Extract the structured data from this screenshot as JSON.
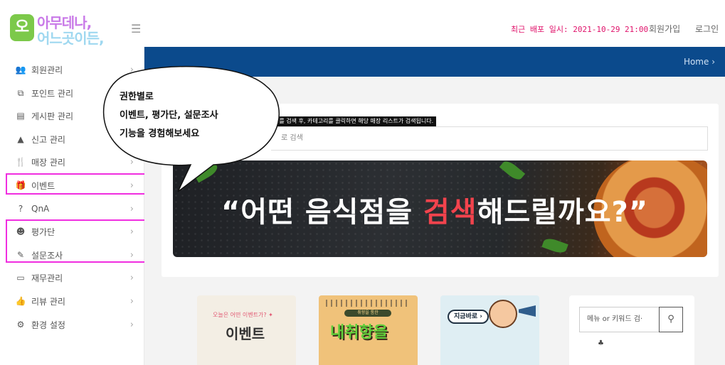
{
  "header": {
    "logo_badge": "오",
    "logo_line1": "아무데나,",
    "logo_line2": "어느곳이든,",
    "menu_icon": "hamburger-icon",
    "deploy_text": "최근 배포 일시: 2021-10-29 21:00",
    "signup": "회원가입",
    "login": "로그인",
    "accent_color": "#e0116a"
  },
  "sidebar": {
    "items": [
      {
        "icon": "users-icon",
        "glyph": "👥",
        "label": "회원관리",
        "arrow": "›"
      },
      {
        "icon": "point-icon",
        "glyph": "⧉",
        "label": "포인트 관리",
        "arrow": "›"
      },
      {
        "icon": "document-icon",
        "glyph": "▤",
        "label": "게시판 관리",
        "arrow": "›"
      },
      {
        "icon": "warning-icon",
        "glyph": "▲",
        "label": "신고 관리",
        "arrow": "›"
      },
      {
        "icon": "restaurant-icon",
        "glyph": "🍴",
        "label": "매장 관리",
        "arrow": "›"
      },
      {
        "icon": "gift-icon",
        "glyph": "🎁",
        "label": "이벤트",
        "arrow": "›"
      },
      {
        "icon": "question-icon",
        "glyph": "?",
        "label": "QnA",
        "arrow": "›"
      },
      {
        "icon": "smile-icon",
        "glyph": "☻",
        "label": "평가단",
        "arrow": "›"
      },
      {
        "icon": "edit-icon",
        "glyph": "✎",
        "label": "설문조사",
        "arrow": "›"
      },
      {
        "icon": "card-icon",
        "glyph": "▭",
        "label": "재무관리",
        "arrow": "›"
      },
      {
        "icon": "thumbs-up-icon",
        "glyph": "👍",
        "label": "리뷰 관리",
        "arrow": "›"
      },
      {
        "icon": "gear-icon",
        "glyph": "⚙",
        "label": "환경 설정",
        "arrow": "›"
      }
    ],
    "highlight_color": "#f02ee0"
  },
  "breadcrumb": {
    "home": "Home ›"
  },
  "search": {
    "hint": "소를 검색 후, 카테고리를 클릭하면 해당 매장 리스트가 검색됩니다.",
    "placeholder": "로 검색"
  },
  "banner": {
    "quote_open": "“",
    "part1": "어떤 음식점을 ",
    "part_red": "검색",
    "part2": "해드릴까요?",
    "quote_close": "”",
    "highlight_color": "#f2434d"
  },
  "cards": [
    {
      "top": "오늘은 어떤 이벤트가? ✦",
      "main": "이벤트"
    },
    {
      "sub": "취향을 통한",
      "main": "내취향을"
    },
    {
      "badge": "지금바로 ›"
    }
  ],
  "side_search": {
    "placeholder": "메뉴 or 키워드 검·",
    "button_icon": "search-icon",
    "glyph": "⚲",
    "mark": "♣"
  },
  "callout": {
    "line1": "권한별로",
    "line2": "이벤트, 평가단, 설문조사",
    "line3": "기능을 경험해보세요"
  }
}
